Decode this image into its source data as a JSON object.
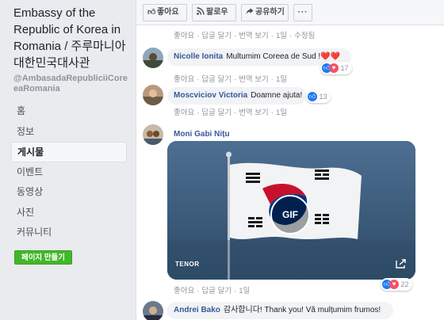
{
  "page": {
    "name": "Embassy of the Republic of Korea in Romania / 주루마니아대한민국대사관",
    "handle": "@AmbasadaRepubliciiCoreeaRomania"
  },
  "nav": {
    "items": [
      {
        "label": "홈",
        "active": false
      },
      {
        "label": "정보",
        "active": false
      },
      {
        "label": "게시물",
        "active": true
      },
      {
        "label": "이벤트",
        "active": false
      },
      {
        "label": "동영상",
        "active": false
      },
      {
        "label": "사진",
        "active": false
      },
      {
        "label": "커뮤니티",
        "active": false
      }
    ],
    "create_page": "페이지 만들기"
  },
  "actionbar": {
    "like": "좋아요",
    "follow": "팔로우",
    "share": "공유하기",
    "more": "···"
  },
  "top_meta": {
    "like": "좋아요",
    "reply": "답글 달기",
    "translate": "번역 보기",
    "time": "1일",
    "edited": "수정됨"
  },
  "comments": [
    {
      "author": "Nicolle Ionita",
      "text": "Multumim Coreea de Sud !❤️❤️",
      "reaction_count": "17",
      "meta": {
        "like": "좋아요",
        "reply": "답글 달기",
        "translate": "번역 보기",
        "time": "1일"
      }
    },
    {
      "author": "Moscviciov Victoria",
      "text": "Doamne ajuta!",
      "reaction_count": "13",
      "meta": {
        "like": "좋아요",
        "reply": "답글 달기",
        "translate": "번역 보기",
        "time": "1일"
      }
    },
    {
      "author": "Moni Gabi Nițu",
      "gif": {
        "badge": "GIF",
        "provider": "TENOR"
      },
      "reaction_count": "22",
      "meta": {
        "like": "좋아요",
        "reply": "답글 달기",
        "time": "1일"
      }
    },
    {
      "author": "Andrei Bako",
      "text": "감사합니다! Thank you! Vă mulțumim frumos!"
    }
  ],
  "colors": {
    "link": "#385898",
    "like": "#2078f4",
    "love": "#f25268",
    "create_button": "#42b72a"
  }
}
